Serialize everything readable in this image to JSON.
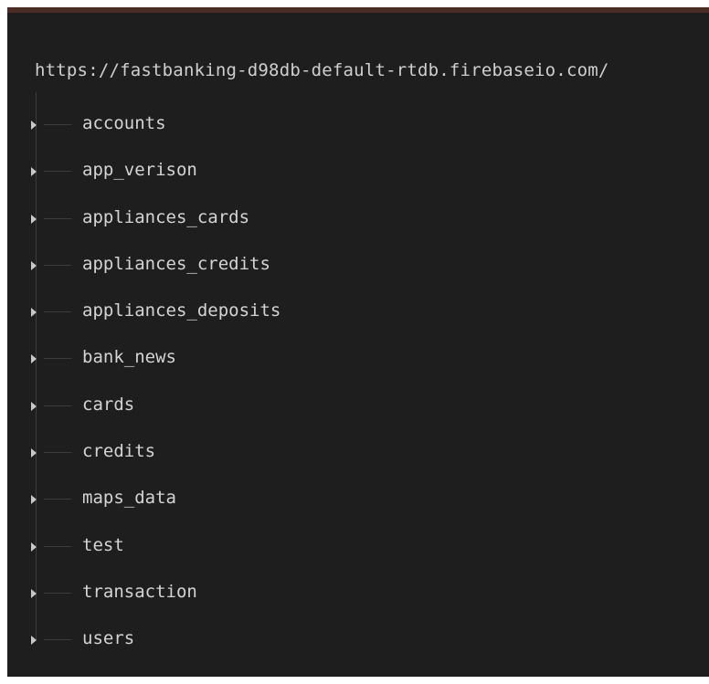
{
  "database": {
    "root_url": "https://fastbanking-d98db-default-rtdb.firebaseio.com/",
    "nodes": [
      {
        "key": "accounts"
      },
      {
        "key": "app_verison"
      },
      {
        "key": "appliances_cards"
      },
      {
        "key": "appliances_credits"
      },
      {
        "key": "appliances_deposits"
      },
      {
        "key": "bank_news"
      },
      {
        "key": "cards"
      },
      {
        "key": "credits"
      },
      {
        "key": "maps_data"
      },
      {
        "key": "test"
      },
      {
        "key": "transaction"
      },
      {
        "key": "users"
      }
    ]
  },
  "icons": {
    "expand": "caret-right-icon"
  },
  "colors": {
    "background": "#1e1e1e",
    "text": "#d4d4d4",
    "top_bar": "#4a2d25"
  }
}
